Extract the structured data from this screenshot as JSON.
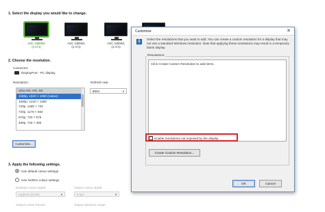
{
  "main": {
    "step1_title": "1. Select the display you would like to change.",
    "displays": [
      {
        "name": "AOC 2490W1",
        "index": "(4 of 4)",
        "selected": true
      },
      {
        "name": "AOC 2490W1",
        "index": "(2 of 4)",
        "selected": false
      },
      {
        "name": "AOC 2490W1",
        "index": "(3 of 4)",
        "selected": false
      }
    ],
    "step2_title": "2. Choose the resolution.",
    "connector_label": "Connector:",
    "connector_value": "DisplayPort - PC display",
    "resolution_label": "Resolution:",
    "refresh_label": "Refresh rate:",
    "refresh_value": "60Hz",
    "resolution_list": {
      "header": "Ultra HD, HD, SD",
      "items": [
        "1080p, 1920 × 1080 (native)",
        "1080p, 1440 × 1080",
        "720p, 1280 × 720",
        "720p, 1176 × 664",
        "576p, 720 × 576",
        "480p, 720 × 480"
      ],
      "selected_index": 0
    },
    "customise_button": "Customise...",
    "step3_title": "3. Apply the following settings.",
    "radio_default": "Use default colour settings",
    "radio_nvidia": "Use NVIDIA colour settings",
    "desktop_depth_label": "Desktop colour depth:",
    "desktop_depth_value": "Highest (32-bit)",
    "output_depth_label": "Output colour depth:",
    "output_depth_value": "8 bpc",
    "output_format_label": "Output colour format:",
    "output_range_label": "Output dynamic range:"
  },
  "dialog": {
    "title": "Customise",
    "description": "Select the resolutions that you want to add. You can create a custom resolution for a display that may not use a standard Windows resolution. Note that applying these resolutions may result in a temporary blank display.",
    "group_label": "Resolutions:",
    "list_hint": "Click Create Custom Resolution to add items.",
    "checkbox_label": "Enable resolutions not exposed by the display",
    "checkbox_checked": true,
    "create_button": "Create Custom Resolution...",
    "ok_button": "OK",
    "cancel_button": "Cancel",
    "highlight_color": "#d9232a"
  }
}
